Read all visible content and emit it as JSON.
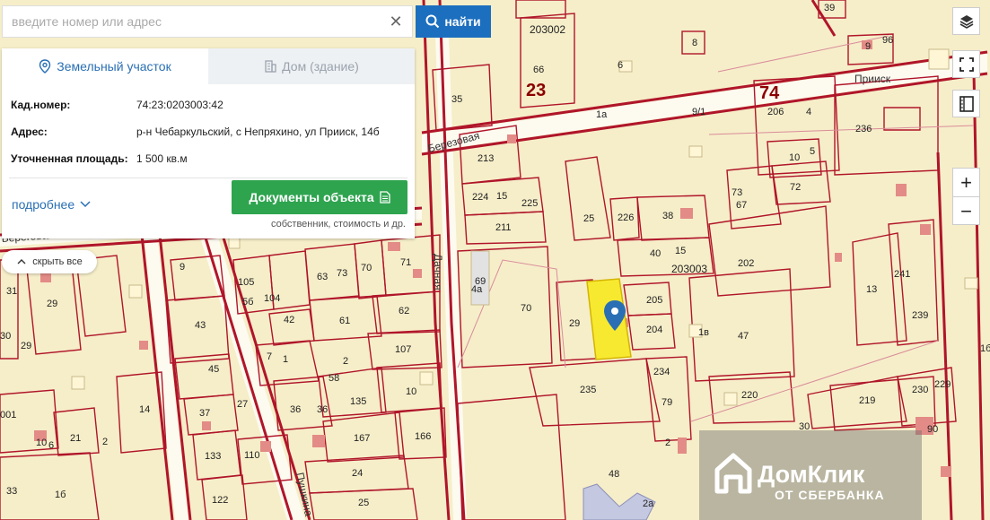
{
  "search": {
    "placeholder": "введите номер или адрес",
    "value": "",
    "find_label": "найти"
  },
  "tabs": [
    {
      "label": "Земельный участок",
      "active": true
    },
    {
      "label": "Дом (здание)",
      "active": false
    }
  ],
  "parcel": {
    "cad_label": "Кад.номер:",
    "cad_value": "74:23:0203003:42",
    "addr_label": "Адрес:",
    "addr_value": "р-н Чебаркульский, с Непряхино, ул Прииск, 14б",
    "area_label": "Уточненная площадь:",
    "area_value": "1 500 кв.м"
  },
  "more_label": "подробнее",
  "doc_button": "Документы объекта",
  "doc_sub": "собственник, стоимость и др.",
  "hide_label": "скрыть все",
  "logo": {
    "title": "ДомКлик",
    "subtitle": "ОТ СБЕРБАНКА"
  },
  "colors": {
    "map_bg": "#f6eec9",
    "boundary": "#b0152a",
    "selected": "#f7e930",
    "brand_blue": "#1c6fbf",
    "doc_green": "#2ea44f"
  },
  "map": {
    "big_labels": [
      "23",
      "74"
    ],
    "block_labels": [
      "203002",
      "203003"
    ],
    "roads": [
      "Прииск",
      "Березовая",
      "Дачная",
      "Пушкина",
      "Береговая"
    ],
    "parcels": [
      "66",
      "35",
      "8",
      "6",
      "9",
      "96",
      "39",
      "1а",
      "9/1",
      "206",
      "4",
      "236",
      "213",
      "224",
      "15",
      "225",
      "10",
      "5",
      "72",
      "73",
      "67",
      "211",
      "25",
      "226",
      "38",
      "40",
      "15",
      "202",
      "241",
      "13",
      "239",
      "69",
      "4а",
      "70",
      "29",
      "205",
      "204",
      "1в",
      "47",
      "9",
      "105",
      "5б",
      "104",
      "63",
      "73",
      "70",
      "71",
      "62",
      "42",
      "61",
      "107",
      "2",
      "1",
      "7",
      "58",
      "135",
      "10",
      "43",
      "45",
      "27",
      "37",
      "36",
      "36",
      "167",
      "166",
      "14",
      "21",
      "2",
      "10",
      "6",
      "110",
      "133",
      "24",
      "122",
      "25",
      "234",
      "235",
      "79",
      "220",
      "30",
      "219",
      "230",
      "229",
      "90",
      "2",
      "48",
      "2а",
      "1б",
      "31",
      "29",
      "30",
      "29",
      "001",
      "33",
      "1б",
      "4"
    ]
  }
}
